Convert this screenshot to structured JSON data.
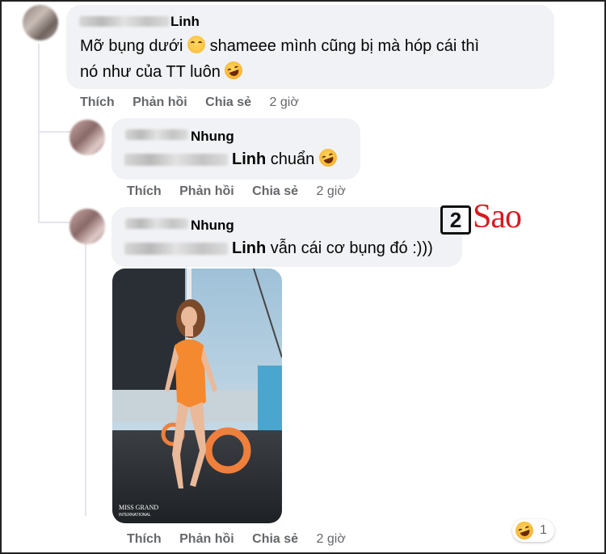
{
  "comments": [
    {
      "author_suffix": "Linh",
      "text_line1": "Mỡ bụng dưới",
      "text_line1_b": "shameee mình cũng bị mà hóp cái thì",
      "text_line2": "nó như của TT luôn",
      "actions": {
        "like": "Thích",
        "reply": "Phản hồi",
        "share": "Chia sẻ",
        "time": "2 giờ"
      }
    },
    {
      "author_suffix": "Nhung",
      "mention": "Linh",
      "text": "chuẩn",
      "actions": {
        "like": "Thích",
        "reply": "Phản hồi",
        "share": "Chia sẻ",
        "time": "2 giờ"
      }
    },
    {
      "author_suffix": "Nhung",
      "mention": "Linh",
      "text": "vẫn cái cơ bụng đó :)))",
      "photo_watermark": "MISS GRAND INTERNATIONAL",
      "actions": {
        "like": "Thích",
        "reply": "Phản hồi",
        "share": "Chia sẻ",
        "time": "2 giờ"
      },
      "reaction_count": "1"
    }
  ],
  "watermark": {
    "number": "2",
    "word": "Sao"
  }
}
